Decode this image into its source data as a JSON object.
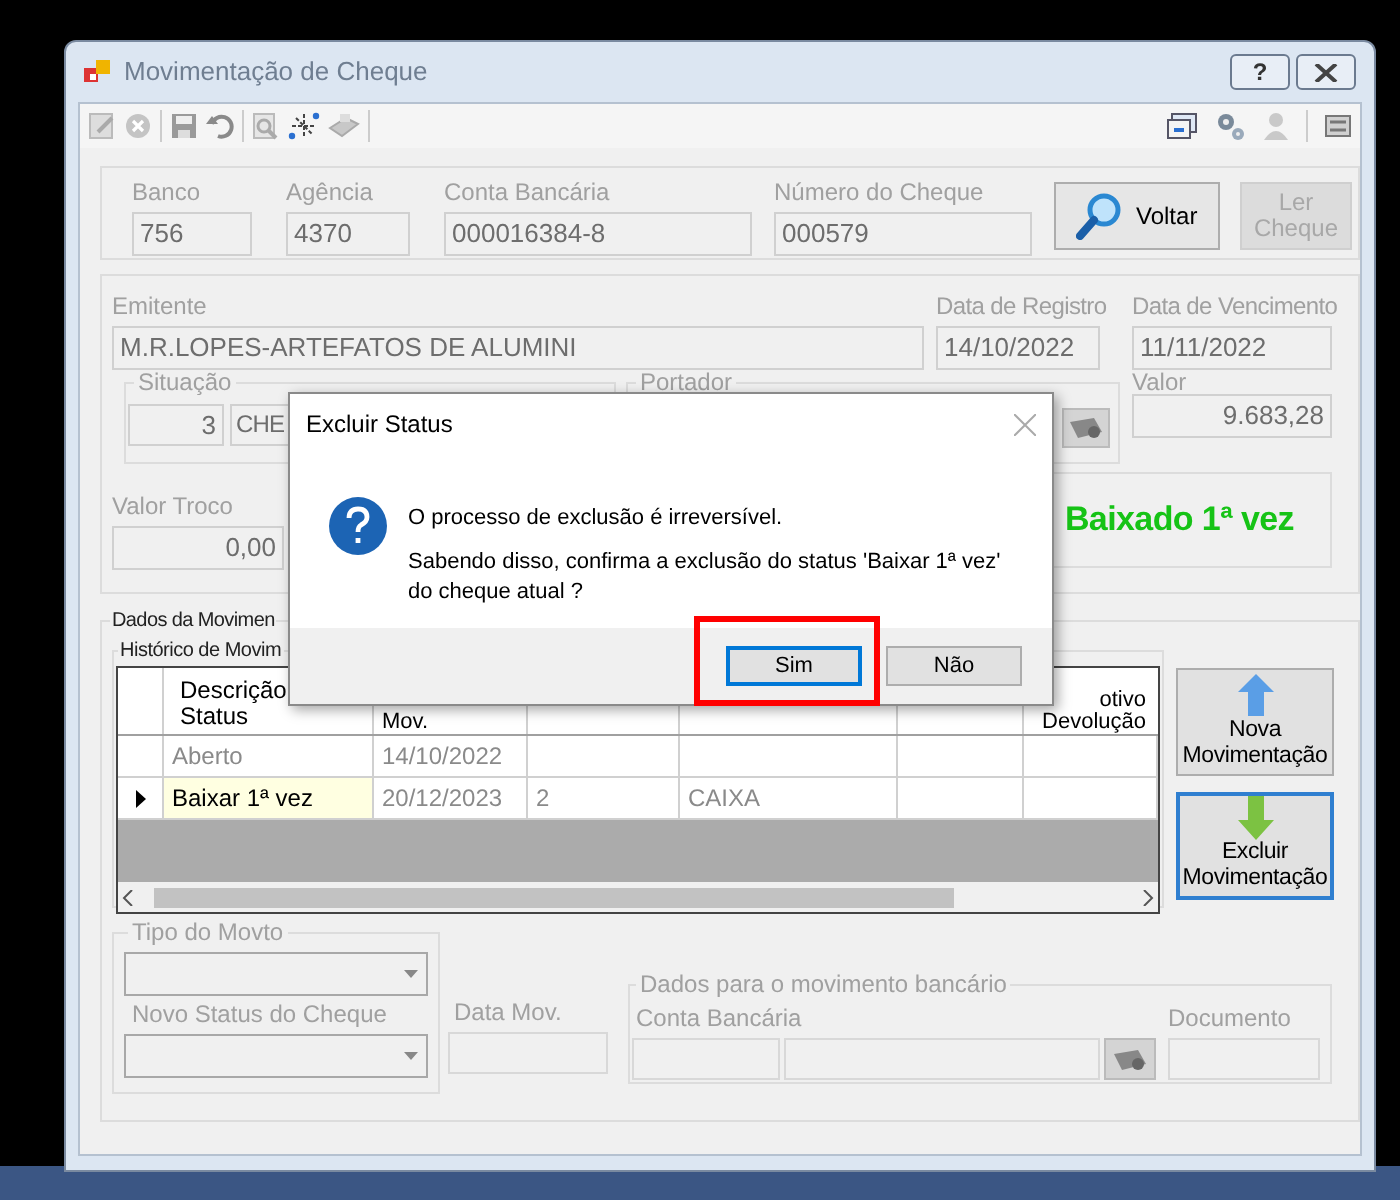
{
  "window": {
    "title": "Movimentação de Cheque",
    "help_button": "?"
  },
  "cheque": {
    "fields": [
      {
        "label": "Banco",
        "value": "756"
      },
      {
        "label": "Agência",
        "value": "4370"
      },
      {
        "label": "Conta Bancária",
        "value": "000016384-8"
      },
      {
        "label": "Número do Cheque",
        "value": "000579"
      }
    ],
    "buttons": [
      {
        "label": "Voltar",
        "disabled": false
      },
      {
        "label": "Ler Cheque",
        "disabled": true
      }
    ]
  },
  "emitente": {
    "label": "Emitente",
    "value": "M.R.LOPES-ARTEFATOS DE ALUMINI"
  },
  "data_registro": {
    "label": "Data de Registro",
    "value": "14/10/2022"
  },
  "data_vencimento": {
    "label": "Data de Vencimento",
    "value": "11/11/2022"
  },
  "situacao": {
    "label": "Situação",
    "code": "3",
    "description": "CHE"
  },
  "portador": {
    "label": "Portador"
  },
  "valor": {
    "label": "Valor",
    "value": "9.683,28"
  },
  "valor_troco": {
    "label": "Valor Troco",
    "value": "0,00"
  },
  "status_text": "Baixado 1ª vez",
  "movimentacao": {
    "title": "Dados da Movimen",
    "history_title": "Histórico de Movim",
    "columns": {
      "status": "Descrição Status",
      "date": "Mov.",
      "column_6": "otivo Devolução"
    },
    "rows": [
      {
        "status": "Aberto",
        "date": "14/10/2022",
        "selected": false
      },
      {
        "status": "Baixar 1ª vez",
        "date": "20/12/2023",
        "column_3": "2",
        "column_4": "CAIXA",
        "selected": true
      }
    ],
    "buttons": [
      {
        "label": "Nova Movimentação",
        "kind": "add",
        "focused": false
      },
      {
        "label": "Excluir Movimentação",
        "kind": "delete",
        "focused": true
      }
    ]
  },
  "tipo_movto": {
    "label": "Tipo do Movto"
  },
  "novo_status": {
    "label": "Novo Status do Cheque"
  },
  "data_mov": {
    "label": "Data Mov."
  },
  "dados_bancario": {
    "title": "Dados para o movimento bancário",
    "conta_label": "Conta Bancária",
    "documento_label": "Documento"
  },
  "dialog": {
    "title": "Excluir Status",
    "lines": [
      "O processo de exclusão é irreversível.",
      "Sabendo disso, confirma a exclusão do status 'Baixar 1ª vez' do cheque atual ?"
    ],
    "buttons": [
      {
        "label": "Sim",
        "focused": true
      },
      {
        "label": "Não",
        "focused": false
      }
    ]
  }
}
